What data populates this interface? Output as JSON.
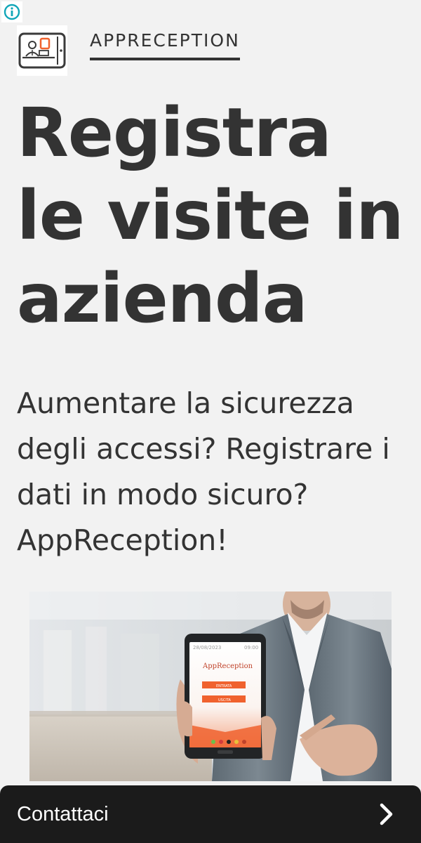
{
  "info_icon": "info-icon",
  "header": {
    "logo_icon": "reception-desk-logo-icon",
    "brand_name": "APPRECEPTION"
  },
  "hero": {
    "title": "Registra le visite in azienda",
    "lead": "Aumentare la sicurezza degli accessi? Registrare i dati in modo sicuro? AppReception!"
  },
  "image": {
    "description_icon": "tablet-app-photo",
    "tablet": {
      "date": "28/08/2023",
      "time": "09:00",
      "app_title": "AppReception",
      "button_1": "ENTRATA",
      "button_2": "USCITA"
    }
  },
  "cta": {
    "label": "Contattaci",
    "icon": "chevron-right-icon"
  },
  "colors": {
    "background": "#f2f2f2",
    "text": "#333333",
    "cta_background": "#1b1b1b",
    "accent_orange": "#f0622e",
    "info_teal": "#11a6b8"
  }
}
